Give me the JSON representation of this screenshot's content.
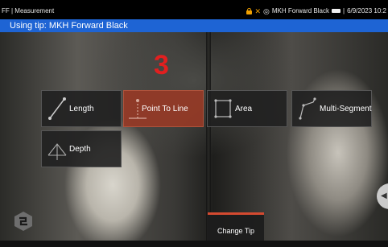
{
  "status": {
    "left": "FF | Measurement",
    "probe": "MKH Forward Black",
    "datetime": "6/9/2023 10:2"
  },
  "tip_bar": "Using tip: MKH Forward Black",
  "countdown": "3",
  "tools": {
    "length": "Length",
    "point_to_line": "Point To Line",
    "area": "Area",
    "multi_segment": "Multi-Segment",
    "depth": "Depth"
  },
  "selected_tool": "Point To Line",
  "change_tip": "Change Tip",
  "colors": {
    "tip_bar": "#1e64d4",
    "selected": "#963a26",
    "countdown": "#e21f1f",
    "status_icon": "#f0a000"
  }
}
